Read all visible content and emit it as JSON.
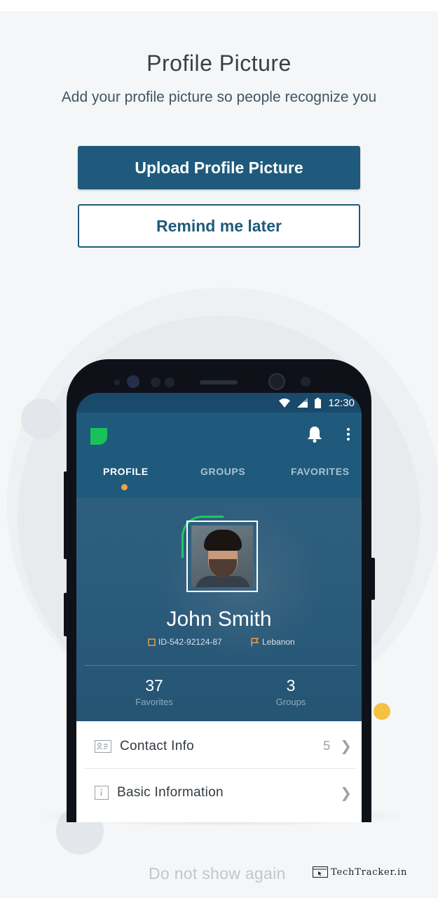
{
  "page": {
    "title": "Profile Picture",
    "subtitle": "Add your profile picture so people recognize you",
    "upload_label": "Upload Profile Picture",
    "remind_label": "Remind me later",
    "dont_show_label": "Do not show again",
    "watermark": "TechTracker.in"
  },
  "phone": {
    "status": {
      "time": "12:30"
    },
    "tabs": [
      {
        "label": "PROFILE",
        "active": true
      },
      {
        "label": "GROUPS",
        "active": false
      },
      {
        "label": "FAVORITES",
        "active": false
      }
    ],
    "profile": {
      "name": "John Smith",
      "id": "ID-542-92124-87",
      "location": "Lebanon",
      "stats": [
        {
          "value": "37",
          "label": "Favorites"
        },
        {
          "value": "3",
          "label": "Groups"
        }
      ]
    },
    "list": [
      {
        "label": "Contact Info",
        "count": "5"
      },
      {
        "label": "Basic Information",
        "count": ""
      }
    ]
  },
  "colors": {
    "primary": "#1f5a7c",
    "accent_green": "#17c25a",
    "accent_orange": "#f0a14a",
    "accent_yellow": "#f5c143"
  }
}
